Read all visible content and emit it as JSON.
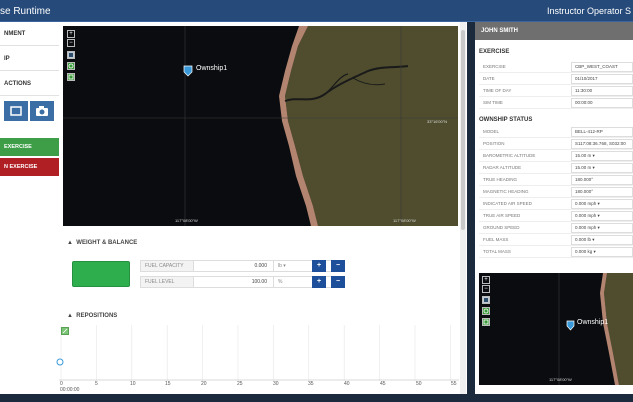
{
  "titlebar": {
    "left_title": "se Runtime",
    "right_title": "Instructor Operator S"
  },
  "sidebar": {
    "items": [
      {
        "label": "NMENT"
      },
      {
        "label": "IP"
      },
      {
        "label": "ACTIONS"
      }
    ],
    "exercise_buttons": [
      {
        "label": "EXERCISE",
        "color": "#3e9e47"
      },
      {
        "label": "N EXERCISE",
        "color": "#b01f24"
      }
    ]
  },
  "map": {
    "ownship_label": "Ownship1",
    "coord_bottom_left": "117°08'00\"W",
    "coord_bottom_right": "117°08'00\"W",
    "coord_right": "33°16'00\"N",
    "accent": "#3a9ad9"
  },
  "weight_balance": {
    "title": "WEIGHT & BALANCE",
    "swatch_color": "#2fae4d",
    "rows": [
      {
        "label": "FUEL CAPACITY",
        "value": "0.000",
        "unit": "lb"
      },
      {
        "label": "FUEL LEVEL",
        "value": "100.00",
        "unit": "%"
      }
    ],
    "plus_label": "+",
    "minus_label": "−"
  },
  "repositions": {
    "title": "REPOSITIONS",
    "ticks": [
      "0",
      "5",
      "10",
      "15",
      "20",
      "25",
      "30",
      "35",
      "40",
      "45",
      "50",
      "55"
    ],
    "time": "00:00:00"
  },
  "right_panel": {
    "user": "JOHN SMITH",
    "exercise_title": "EXERCISE",
    "exercise_rows": [
      {
        "label": "EXERCISE",
        "value": "CBP_WEST_COAST"
      },
      {
        "label": "DATE",
        "value": "01/10/2017"
      },
      {
        "label": "TIME OF DAY",
        "value": "11:30:00"
      },
      {
        "label": "SIM TIME",
        "value": "00:00:00"
      }
    ],
    "ownship_title": "OWNSHIP STATUS",
    "ownship_rows": [
      {
        "label": "MODEL",
        "value": "BELL-412-RP"
      },
      {
        "label": "POSITION",
        "value": "S117:08:36.768, S032:00"
      },
      {
        "label": "BAROMETRIC ALTITUDE",
        "value": "15.00 m ▾"
      },
      {
        "label": "RADAR ALTITUDE",
        "value": "15.00 m ▾"
      },
      {
        "label": "TRUE HEADING",
        "value": "180.000°"
      },
      {
        "label": "MAGNETIC HEADING",
        "value": "180.000°"
      },
      {
        "label": "INDICATED AIR SPEED",
        "value": "0.000 mph ▾"
      },
      {
        "label": "TRUE AIR SPEED",
        "value": "0.000 mph ▾"
      },
      {
        "label": "GROUND SPEED",
        "value": "0.000 mph ▾"
      },
      {
        "label": "FUEL MASS",
        "value": "0.000 lb ▾"
      },
      {
        "label": "TOTAL MASS",
        "value": "0.000 kg ▾"
      }
    ],
    "mini_map_label": "Ownship1",
    "mini_map_coord": "117°08'00\"W"
  }
}
